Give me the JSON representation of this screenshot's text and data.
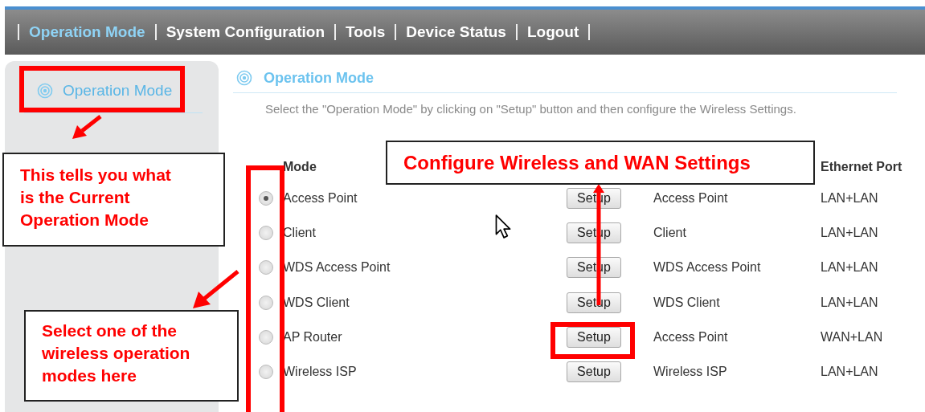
{
  "nav": [
    {
      "label": "Operation Mode",
      "selected": true
    },
    {
      "label": "System Configuration",
      "selected": false
    },
    {
      "label": "Tools",
      "selected": false
    },
    {
      "label": "Device Status",
      "selected": false
    },
    {
      "label": "Logout",
      "selected": false
    }
  ],
  "sidebar": {
    "items": [
      {
        "label": "Operation Mode",
        "selected": true
      }
    ]
  },
  "section": {
    "title": "Operation Mode",
    "description": "Select the \"Operation Mode\" by clicking on \"Setup\" button and then configure the Wireless Settings."
  },
  "table": {
    "columns": {
      "mode": "Mode",
      "ethernet_port": "Ethernet Port"
    },
    "rows": [
      {
        "selected": true,
        "mode": "Access Point",
        "button": "Setup",
        "column_3": "Access Point",
        "ethernet_port": "LAN+LAN"
      },
      {
        "selected": false,
        "mode": "Client",
        "button": "Setup",
        "column_3": "Client",
        "ethernet_port": "LAN+LAN"
      },
      {
        "selected": false,
        "mode": "WDS Access Point",
        "button": "Setup",
        "column_3": "WDS Access Point",
        "ethernet_port": "LAN+LAN"
      },
      {
        "selected": false,
        "mode": "WDS Client",
        "button": "Setup",
        "column_3": "WDS Client",
        "ethernet_port": "LAN+LAN"
      },
      {
        "selected": false,
        "mode": "AP Router",
        "button": "Setup",
        "column_3": "Access Point",
        "ethernet_port": "WAN+LAN"
      },
      {
        "selected": false,
        "mode": "Wireless ISP",
        "button": "Setup",
        "column_3": "Wireless ISP",
        "ethernet_port": "LAN+LAN"
      }
    ]
  },
  "annotations": [
    {
      "text": "This tells you what is the Current Operation Mode"
    },
    {
      "text": "Select one of the wireless operation modes here"
    },
    {
      "text": "Configure Wireless and WAN Settings"
    }
  ]
}
